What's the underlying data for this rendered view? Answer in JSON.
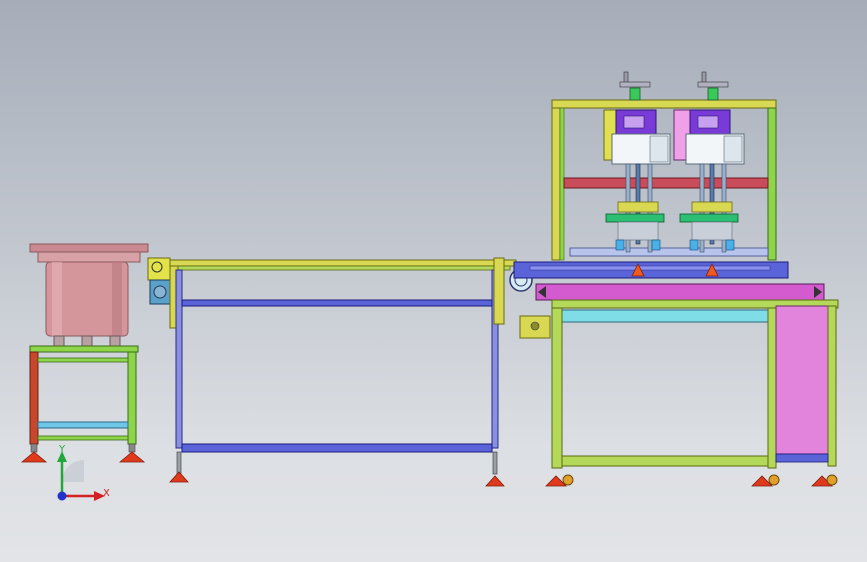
{
  "triad": {
    "y_label": "Y",
    "x_label": "X",
    "y_color": "#22a83a",
    "x_color": "#d42020",
    "z_color": "#2233cc"
  },
  "colors": {
    "frame_green": "#8fd54a",
    "frame_red": "#c7472c",
    "frame_blue": "#5a64d8",
    "frame_yellow": "#d8d852",
    "bowl_pink": "#d4969b",
    "bowl_rim": "#c07e84",
    "magenta": "#d45ad0",
    "pink_panel": "#e384dc",
    "cyan": "#7fdde8",
    "orange_foot": "#e03a1c"
  }
}
